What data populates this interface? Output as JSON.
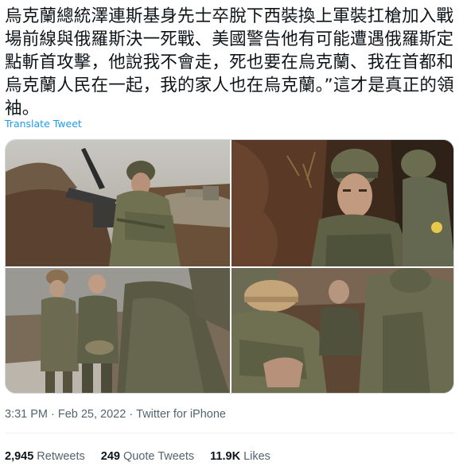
{
  "tweet": {
    "text": "烏克蘭總統澤連斯基身先士卒脫下西裝換上軍裝扛槍加入戰場前線與俄羅斯決一死戰、美國警告他有可能遭遇俄羅斯定點斬首攻擊，他說我不會走，死也要在烏克蘭、我在首都和烏克蘭人民在一起，我的家人也在烏克蘭。”這才是真正的領袖。",
    "translate_label": "Translate Tweet"
  },
  "media": {
    "photos": [
      {
        "icon": "photo-soldier-with-machine-gun-in-trench"
      },
      {
        "icon": "photo-man-in-helmet-closeup"
      },
      {
        "icon": "photo-group-walking-in-snow"
      },
      {
        "icon": "photo-soldiers-in-trench"
      }
    ]
  },
  "meta": {
    "time": "3:31 PM",
    "date": "Feb 25, 2022",
    "source": "Twitter for iPhone",
    "separator": "·"
  },
  "stats": {
    "retweets_count": "2,945",
    "retweets_label": "Retweets",
    "quotes_count": "249",
    "quotes_label": "Quote Tweets",
    "likes_count": "11.9K",
    "likes_label": "Likes"
  },
  "colors": {
    "link": "#1d9bf0",
    "text": "#0f1419",
    "secondary": "#536471"
  }
}
